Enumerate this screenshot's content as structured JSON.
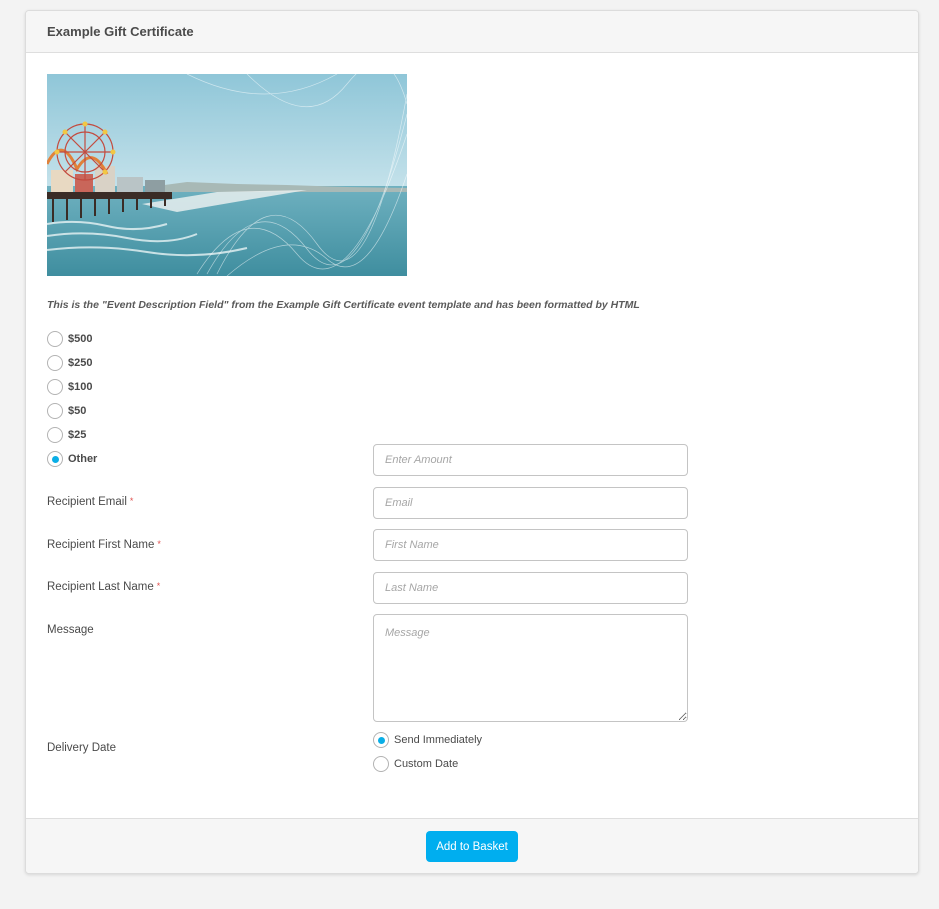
{
  "panel": {
    "title": "Example Gift Certificate",
    "description": "This is the \"Event Description Field\" from the Example Gift Certificate event template and has been formatted by HTML"
  },
  "amount_options": [
    {
      "label": "$500",
      "checked": false
    },
    {
      "label": "$250",
      "checked": false
    },
    {
      "label": "$100",
      "checked": false
    },
    {
      "label": "$50",
      "checked": false
    },
    {
      "label": "$25",
      "checked": false
    },
    {
      "label": "Other",
      "checked": true
    }
  ],
  "amount_input": {
    "placeholder": "Enter Amount",
    "value": ""
  },
  "fields": {
    "recipient_email": {
      "label": "Recipient Email",
      "required_mark": "*",
      "placeholder": "Email"
    },
    "recipient_first_name": {
      "label": "Recipient First Name",
      "required_mark": "*",
      "placeholder": "First Name"
    },
    "recipient_last_name": {
      "label": "Recipient Last Name",
      "required_mark": "*",
      "placeholder": "Last Name"
    },
    "message": {
      "label": "Message",
      "placeholder": "Message"
    }
  },
  "delivery": {
    "label": "Delivery Date",
    "options": [
      {
        "label": "Send Immediately",
        "checked": true
      },
      {
        "label": "Custom Date",
        "checked": false
      }
    ]
  },
  "footer": {
    "add_to_basket": "Add to Basket"
  },
  "colors": {
    "accent": "#00aeef",
    "required": "#e0514f"
  }
}
